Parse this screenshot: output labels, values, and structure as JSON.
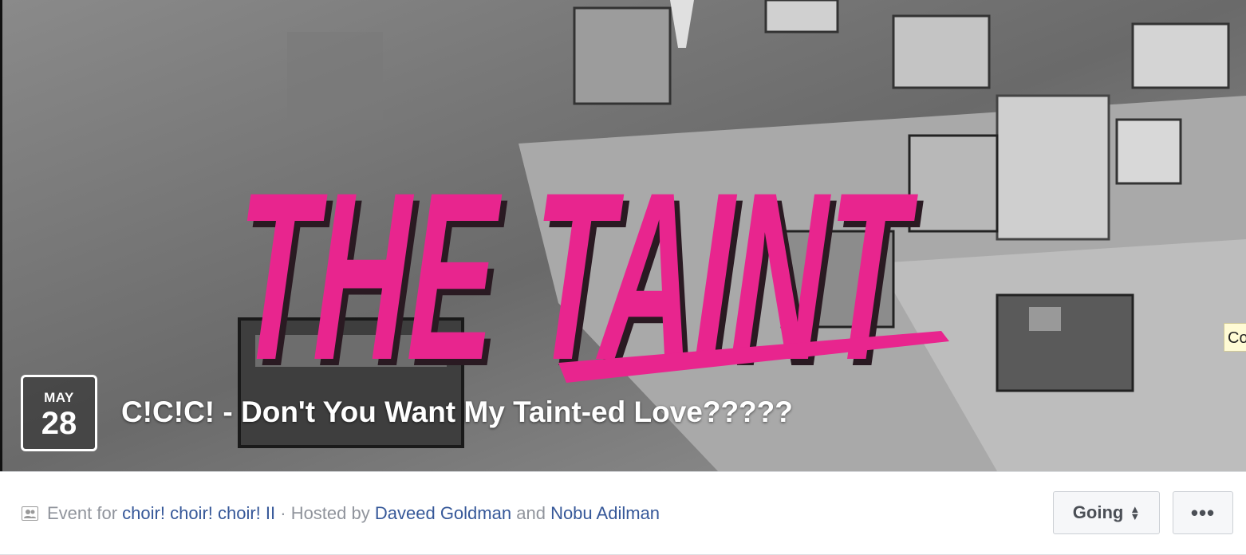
{
  "cover": {
    "logo_text": "THE TAINT",
    "logo_color": "#e8258e",
    "date_month": "MAY",
    "date_day": "28",
    "title": "C!C!C! - Don't You Want My Taint-ed Love?????",
    "tooltip_peek": "Co"
  },
  "info": {
    "icon": "group-icon",
    "prefix": "Event for",
    "group_link": "choir! choir! choir! II",
    "hosted_by": "· Hosted by",
    "host1": "Daveed Goldman",
    "and": "and",
    "host2": "Nobu Adilman"
  },
  "actions": {
    "going_label": "Going",
    "more_label": "•••"
  },
  "colors": {
    "link": "#365899",
    "muted": "#90949c"
  }
}
